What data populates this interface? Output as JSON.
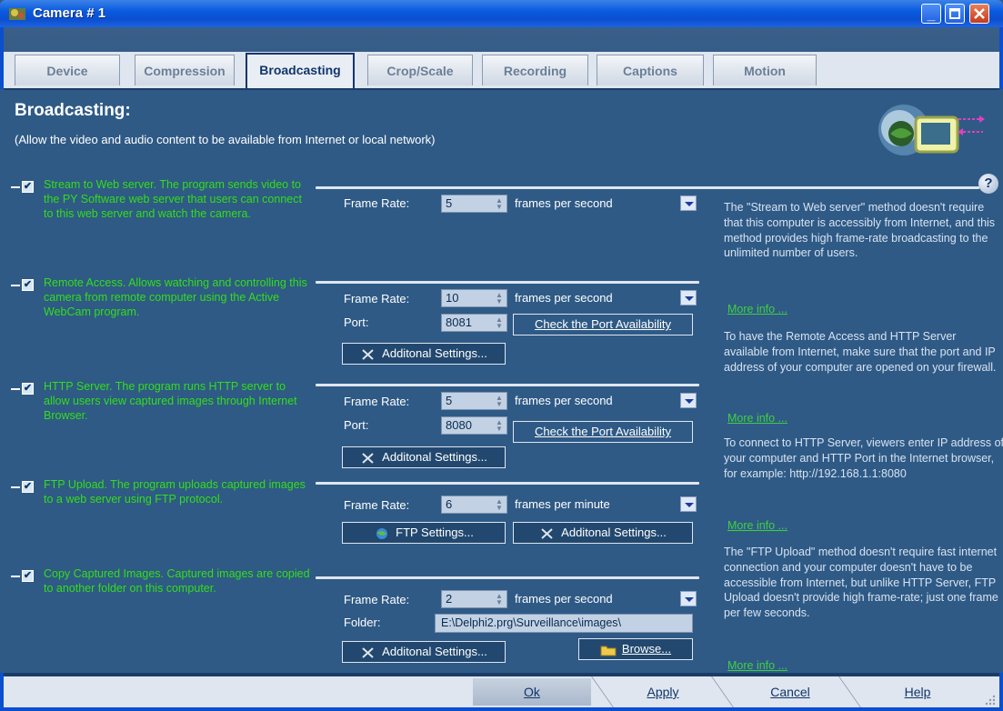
{
  "window": {
    "title": "Camera # 1"
  },
  "tabs": [
    {
      "label": "Device"
    },
    {
      "label": "Compression"
    },
    {
      "label": "Broadcasting"
    },
    {
      "label": "Crop/Scale"
    },
    {
      "label": "Recording"
    },
    {
      "label": "Captions"
    },
    {
      "label": "Motion"
    }
  ],
  "active_tab": "Broadcasting",
  "page": {
    "title": "Broadcasting:",
    "subtitle": "(Allow the video and audio content to be available from Internet or local network)"
  },
  "sections": {
    "web": {
      "description": "Stream to Web server. The program sends video to the PY Software web server that users can connect to this web server and watch the camera.",
      "frame_rate_label": "Frame Rate:",
      "frame_rate": "5",
      "unit": "frames per second"
    },
    "remote": {
      "description": "Remote Access. Allows watching and controlling this camera from remote computer using the Active WebCam program.",
      "frame_rate_label": "Frame Rate:",
      "frame_rate": "10",
      "unit": "frames per second",
      "port_label": "Port:",
      "port": "8081",
      "check_label": "Check the Port Availability",
      "additional_label": "Additonal Settings..."
    },
    "http": {
      "description": "HTTP Server. The program runs HTTP server to allow users view captured images through Internet Browser.",
      "frame_rate_label": "Frame Rate:",
      "frame_rate": "5",
      "unit": "frames per second",
      "port_label": "Port:",
      "port": "8080",
      "check_label": "Check the Port Availability",
      "additional_label": "Additonal Settings..."
    },
    "ftp": {
      "description": "FTP Upload. The program uploads captured images to a web server using FTP protocol.",
      "frame_rate_label": "Frame Rate:",
      "frame_rate": "6",
      "unit": "frames per minute",
      "ftp_settings_label": "FTP Settings...",
      "additional_label": "Additonal Settings..."
    },
    "copy": {
      "description": "Copy Captured Images. Captured images are copied to another folder on this computer.",
      "frame_rate_label": "Frame Rate:",
      "frame_rate": "2",
      "unit": "frames per second",
      "folder_label": "Folder:",
      "folder": "E:\\Delphi2.prg\\Surveillance\\images\\",
      "additional_label": "Additonal Settings...",
      "browse_label": "Browse..."
    }
  },
  "help": {
    "text1": "The \"Stream to Web server\" method doesn't require that this computer is accessibly from Internet, and this method provides high frame-rate broadcasting to the unlimited number of users.",
    "text2": "To have the Remote Access and HTTP Server available from Internet, make sure that the port and IP address of your computer are opened on your firewall.",
    "text3": "To connect to HTTP Server, viewers enter IP address of your computer and HTTP Port in the Internet browser, for example: http://192.168.1.1:8080",
    "text4": "The \"FTP Upload\" method doesn't require fast internet connection and your computer doesn't have to be accessible from Internet, but unlike HTTP Server, FTP Upload doesn't provide high frame-rate; just one frame per few seconds.",
    "more_info": "More info ...",
    "question": "?"
  },
  "footer": {
    "ok": "Ok",
    "apply": "Apply",
    "cancel": "Cancel",
    "help": "Help"
  },
  "colors": {
    "background": "#2f5a86",
    "title_bar": "#0a5be0",
    "description_text": "#39d43a",
    "link": "#3fd040"
  }
}
